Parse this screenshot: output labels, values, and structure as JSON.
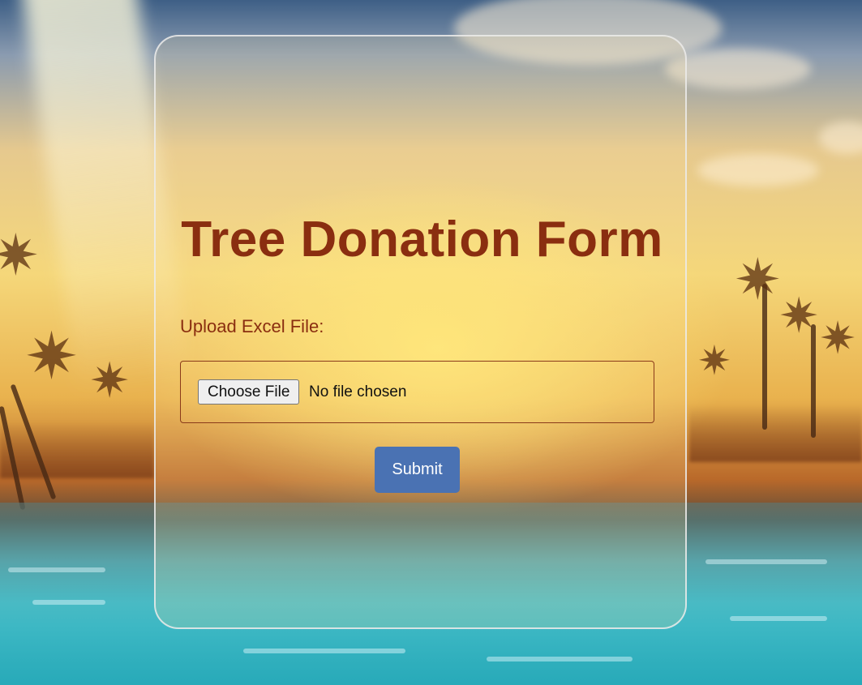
{
  "form": {
    "title": "Tree Donation Form",
    "upload_label": "Upload Excel File:",
    "file_input": {
      "button_label": "Choose File",
      "status_text": "No file chosen"
    },
    "submit_label": "Submit"
  },
  "colors": {
    "title": "#8a2e10",
    "submit_button": "#4a72b3",
    "card_border": "#ebebeb"
  },
  "background": {
    "icon": "tropical-sunset-background"
  }
}
